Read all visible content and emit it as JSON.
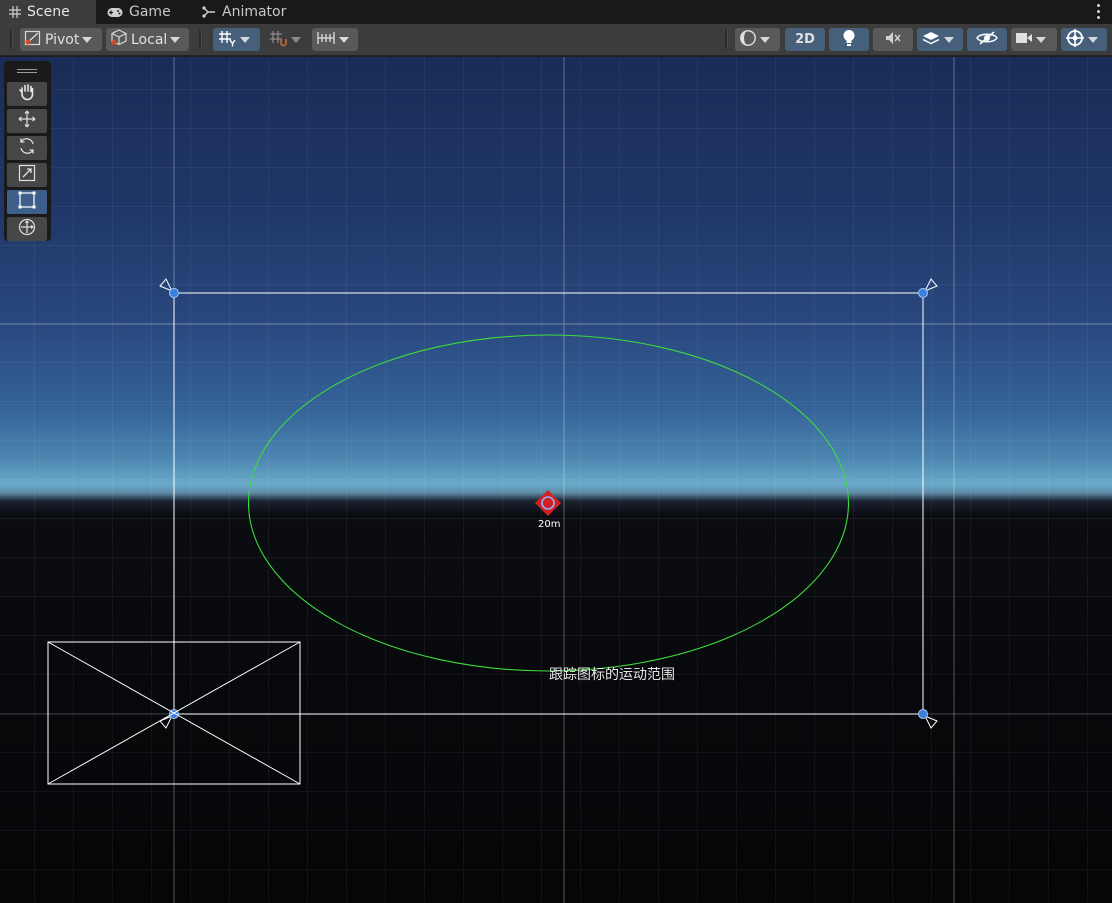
{
  "tabs": [
    {
      "label": "Scene",
      "icon": "grid-icon",
      "active": true
    },
    {
      "label": "Game",
      "icon": "gamepad-icon",
      "active": false
    },
    {
      "label": "Animator",
      "icon": "animator-icon",
      "active": false
    }
  ],
  "toolbar": {
    "pivot_label": "Pivot",
    "local_label": "Local",
    "mode_2d_label": "2D"
  },
  "tools": [
    {
      "name": "hand-tool",
      "icon": "hand-icon",
      "selected": false
    },
    {
      "name": "move-tool",
      "icon": "move-icon",
      "selected": false
    },
    {
      "name": "rotate-tool",
      "icon": "rotate-icon",
      "selected": false
    },
    {
      "name": "scale-tool",
      "icon": "scale-icon",
      "selected": false
    },
    {
      "name": "rect-tool",
      "icon": "rect-icon",
      "selected": true
    },
    {
      "name": "transform-tool",
      "icon": "transform-icon",
      "selected": false
    }
  ],
  "scene": {
    "distance_label": "20m",
    "ellipse_label": "跟踪图标的运动范围",
    "colors": {
      "ellipse": "#3ddc3d",
      "rect": "#ffffff",
      "handle": "#3b7ee0",
      "marker": "#d42020"
    }
  }
}
